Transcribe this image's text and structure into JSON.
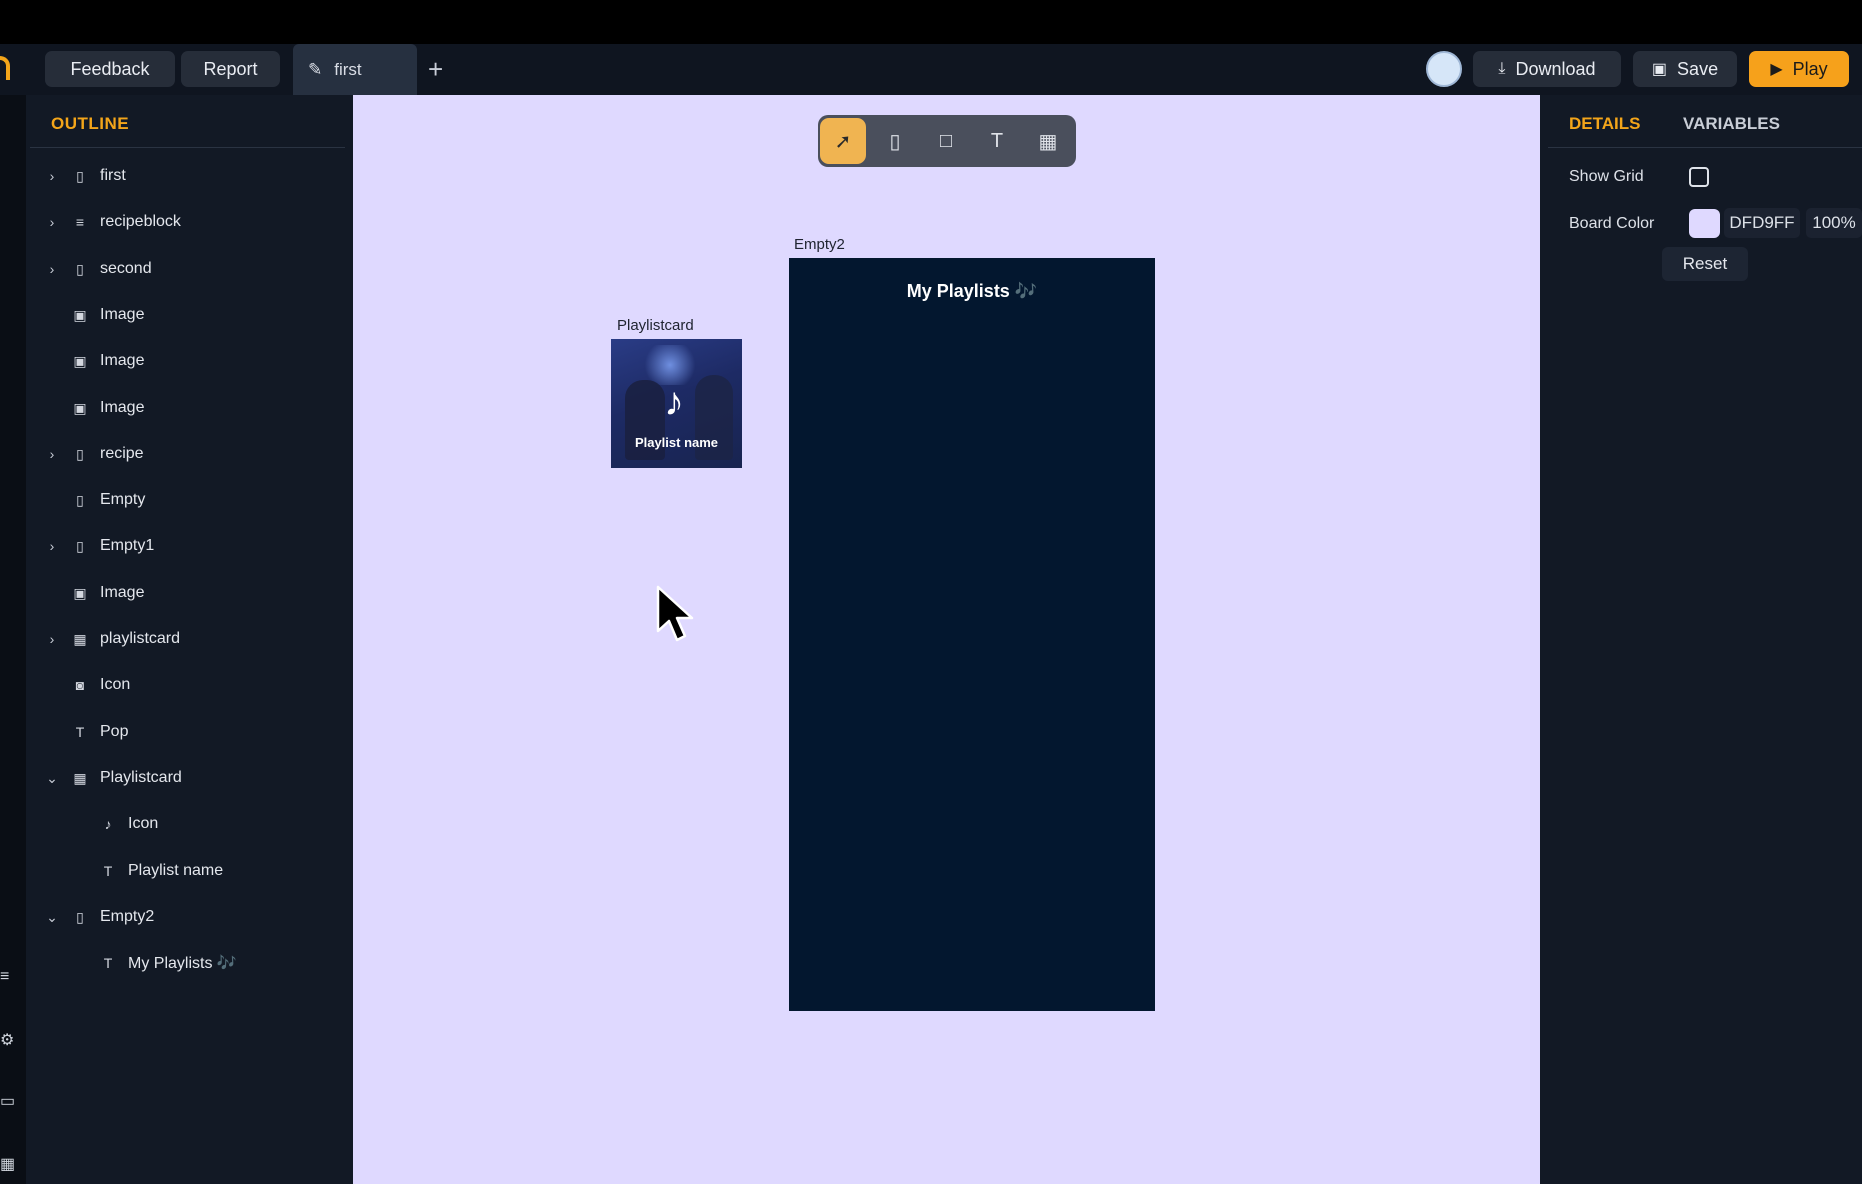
{
  "toolbar": {
    "feedback_label": "Feedback",
    "report_label": "Report",
    "tab_label": "first",
    "add_tab": "+",
    "download_label": "Download",
    "save_label": "Save",
    "play_label": "Play"
  },
  "outline": {
    "title": "OUTLINE",
    "items": [
      {
        "label": "first",
        "icon": "frame-icon",
        "expandable": true,
        "expanded": false,
        "depth": 0
      },
      {
        "label": "recipeblock",
        "icon": "list-icon",
        "expandable": true,
        "expanded": false,
        "depth": 0
      },
      {
        "label": "second",
        "icon": "frame-icon",
        "expandable": true,
        "expanded": false,
        "depth": 0
      },
      {
        "label": "Image",
        "icon": "image-icon",
        "expandable": false,
        "depth": 0
      },
      {
        "label": "Image",
        "icon": "image-icon",
        "expandable": false,
        "depth": 0
      },
      {
        "label": "Image",
        "icon": "image-icon",
        "expandable": false,
        "depth": 0
      },
      {
        "label": "recipe",
        "icon": "frame-icon",
        "expandable": true,
        "expanded": false,
        "depth": 0
      },
      {
        "label": "Empty",
        "icon": "frame-icon",
        "expandable": false,
        "depth": 0
      },
      {
        "label": "Empty1",
        "icon": "frame-icon",
        "expandable": true,
        "expanded": false,
        "depth": 0
      },
      {
        "label": "Image",
        "icon": "image-icon",
        "expandable": false,
        "depth": 0
      },
      {
        "label": "playlistcard",
        "icon": "component-icon",
        "expandable": true,
        "expanded": false,
        "depth": 0
      },
      {
        "label": "Icon",
        "icon": "icon-node-icon",
        "expandable": false,
        "depth": 0
      },
      {
        "label": "Pop",
        "icon": "text-icon",
        "expandable": false,
        "depth": 0
      },
      {
        "label": "Playlistcard",
        "icon": "component-icon",
        "expandable": true,
        "expanded": true,
        "depth": 0
      },
      {
        "label": "Icon",
        "icon": "music-note-icon",
        "expandable": false,
        "depth": 1
      },
      {
        "label": "Playlist name",
        "icon": "text-icon",
        "expandable": false,
        "depth": 1
      },
      {
        "label": "Empty2",
        "icon": "frame-icon",
        "expandable": true,
        "expanded": true,
        "depth": 0
      },
      {
        "label": "My Playlists 🎶",
        "icon": "text-icon",
        "expandable": false,
        "depth": 1
      }
    ]
  },
  "canvas": {
    "background_color": "#DFD9FF",
    "playlistcard_label": "Playlistcard",
    "playlist_name": "Playlist name",
    "empty2_label": "Empty2",
    "my_playlists_text": "My Playlists 🎶"
  },
  "tools": [
    "select-tool",
    "phone-frame-tool",
    "rectangle-tool",
    "text-tool",
    "components-tool"
  ],
  "details": {
    "tab_details": "DETAILS",
    "tab_variables": "VARIABLES",
    "show_grid_label": "Show Grid",
    "show_grid_checked": false,
    "board_color_label": "Board Color",
    "board_color_hex": "DFD9FF",
    "board_color_opacity": "100%",
    "reset_label": "Reset"
  },
  "colors": {
    "accent": "#F3A51A",
    "panel": "#121925",
    "frame_dark": "#03172F"
  }
}
